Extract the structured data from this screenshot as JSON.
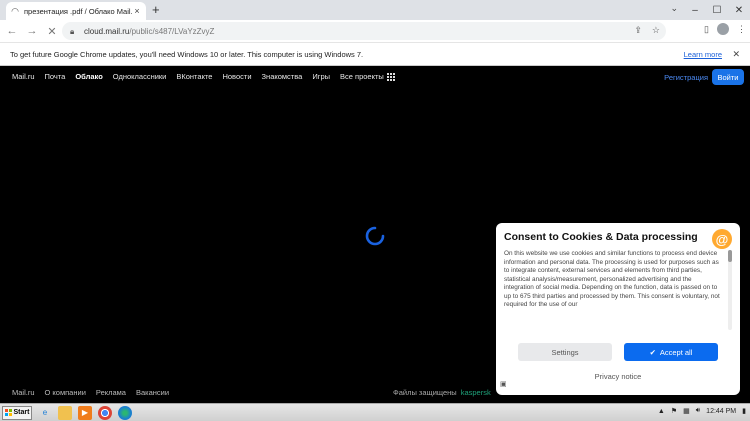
{
  "browser": {
    "tab_title": "презентация .pdf / Облако Mail.ru",
    "tab_close": "×",
    "new_tab": "+",
    "url_host": "cloud.mail.ru",
    "url_path": "/public/s487/LVaYzZvyZ",
    "window_controls": [
      "–",
      "☐",
      "✕"
    ]
  },
  "infobar": {
    "message": "To get future Google Chrome updates, you'll need Windows 10 or later. This computer is using Windows 7.",
    "link": "Learn more",
    "close": "✕"
  },
  "mailru_nav": {
    "links": [
      "Mail.ru",
      "Почта",
      "Облако",
      "Одноклассники",
      "ВКонтакте",
      "Новости",
      "Знакомства",
      "Игры",
      "Все проекты"
    ],
    "active": "Облако",
    "register": "Регистрация",
    "login": "Войти"
  },
  "footer": {
    "left_links": [
      "Mail.ru",
      "О компании",
      "Реклама",
      "Вакансии"
    ],
    "protected_text": "Файлы защищены",
    "protected_brand": "kaspersk"
  },
  "consent": {
    "title": "Consent to Cookies & Data processing",
    "body": "On this website we use cookies and similar functions to process end device information and personal data. The processing is used for purposes such as to integrate content, external services and elements from third parties, statistical analysis/measurement, personalized advertising and the integration of social media. Depending on the function, data is passed on to up to 675 third parties and processed by them. This consent is voluntary, not required for the use of our",
    "settings_label": "Settings",
    "accept_label": "Accept all",
    "privacy_label": "Privacy notice"
  },
  "taskbar": {
    "start_label": "Start",
    "clock": "12:44 PM"
  },
  "colors": {
    "accent_blue": "#0b6bef",
    "mailru_orange": "#ffa930",
    "page_bg": "#000000"
  }
}
